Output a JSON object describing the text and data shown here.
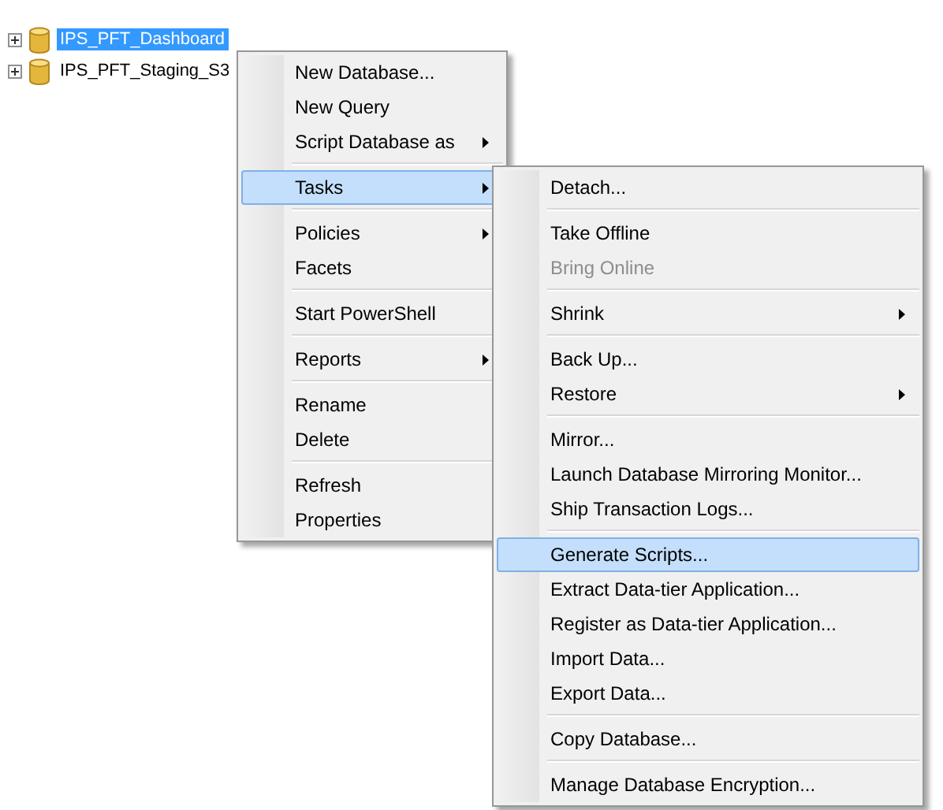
{
  "tree": {
    "nodes": [
      {
        "label": "IPS_PFT_Dashboard",
        "selected": true,
        "expanded": false
      },
      {
        "label": "IPS_PFT_Staging_S3",
        "selected": false,
        "expanded": false
      }
    ]
  },
  "context_menu": {
    "groups": [
      [
        {
          "label": "New Database...",
          "submenu": false,
          "selected": false,
          "disabled": false
        },
        {
          "label": "New Query",
          "submenu": false,
          "selected": false,
          "disabled": false
        },
        {
          "label": "Script Database as",
          "submenu": true,
          "selected": false,
          "disabled": false
        }
      ],
      [
        {
          "label": "Tasks",
          "submenu": true,
          "selected": true,
          "disabled": false
        }
      ],
      [
        {
          "label": "Policies",
          "submenu": true,
          "selected": false,
          "disabled": false
        },
        {
          "label": "Facets",
          "submenu": false,
          "selected": false,
          "disabled": false
        }
      ],
      [
        {
          "label": "Start PowerShell",
          "submenu": false,
          "selected": false,
          "disabled": false
        }
      ],
      [
        {
          "label": "Reports",
          "submenu": true,
          "selected": false,
          "disabled": false
        }
      ],
      [
        {
          "label": "Rename",
          "submenu": false,
          "selected": false,
          "disabled": false
        },
        {
          "label": "Delete",
          "submenu": false,
          "selected": false,
          "disabled": false
        }
      ],
      [
        {
          "label": "Refresh",
          "submenu": false,
          "selected": false,
          "disabled": false
        },
        {
          "label": "Properties",
          "submenu": false,
          "selected": false,
          "disabled": false
        }
      ]
    ]
  },
  "tasks_submenu": {
    "groups": [
      [
        {
          "label": "Detach...",
          "submenu": false,
          "selected": false,
          "disabled": false
        }
      ],
      [
        {
          "label": "Take Offline",
          "submenu": false,
          "selected": false,
          "disabled": false
        },
        {
          "label": "Bring Online",
          "submenu": false,
          "selected": false,
          "disabled": true
        }
      ],
      [
        {
          "label": "Shrink",
          "submenu": true,
          "selected": false,
          "disabled": false
        }
      ],
      [
        {
          "label": "Back Up...",
          "submenu": false,
          "selected": false,
          "disabled": false
        },
        {
          "label": "Restore",
          "submenu": true,
          "selected": false,
          "disabled": false
        }
      ],
      [
        {
          "label": "Mirror...",
          "submenu": false,
          "selected": false,
          "disabled": false
        },
        {
          "label": "Launch Database Mirroring Monitor...",
          "submenu": false,
          "selected": false,
          "disabled": false
        },
        {
          "label": "Ship Transaction Logs...",
          "submenu": false,
          "selected": false,
          "disabled": false
        }
      ],
      [
        {
          "label": "Generate Scripts...",
          "submenu": false,
          "selected": true,
          "disabled": false
        },
        {
          "label": "Extract Data-tier Application...",
          "submenu": false,
          "selected": false,
          "disabled": false
        },
        {
          "label": "Register as Data-tier Application...",
          "submenu": false,
          "selected": false,
          "disabled": false
        },
        {
          "label": "Import Data...",
          "submenu": false,
          "selected": false,
          "disabled": false
        },
        {
          "label": "Export Data...",
          "submenu": false,
          "selected": false,
          "disabled": false
        }
      ],
      [
        {
          "label": "Copy Database...",
          "submenu": false,
          "selected": false,
          "disabled": false
        }
      ],
      [
        {
          "label": "Manage Database Encryption...",
          "submenu": false,
          "selected": false,
          "disabled": false
        }
      ]
    ]
  }
}
